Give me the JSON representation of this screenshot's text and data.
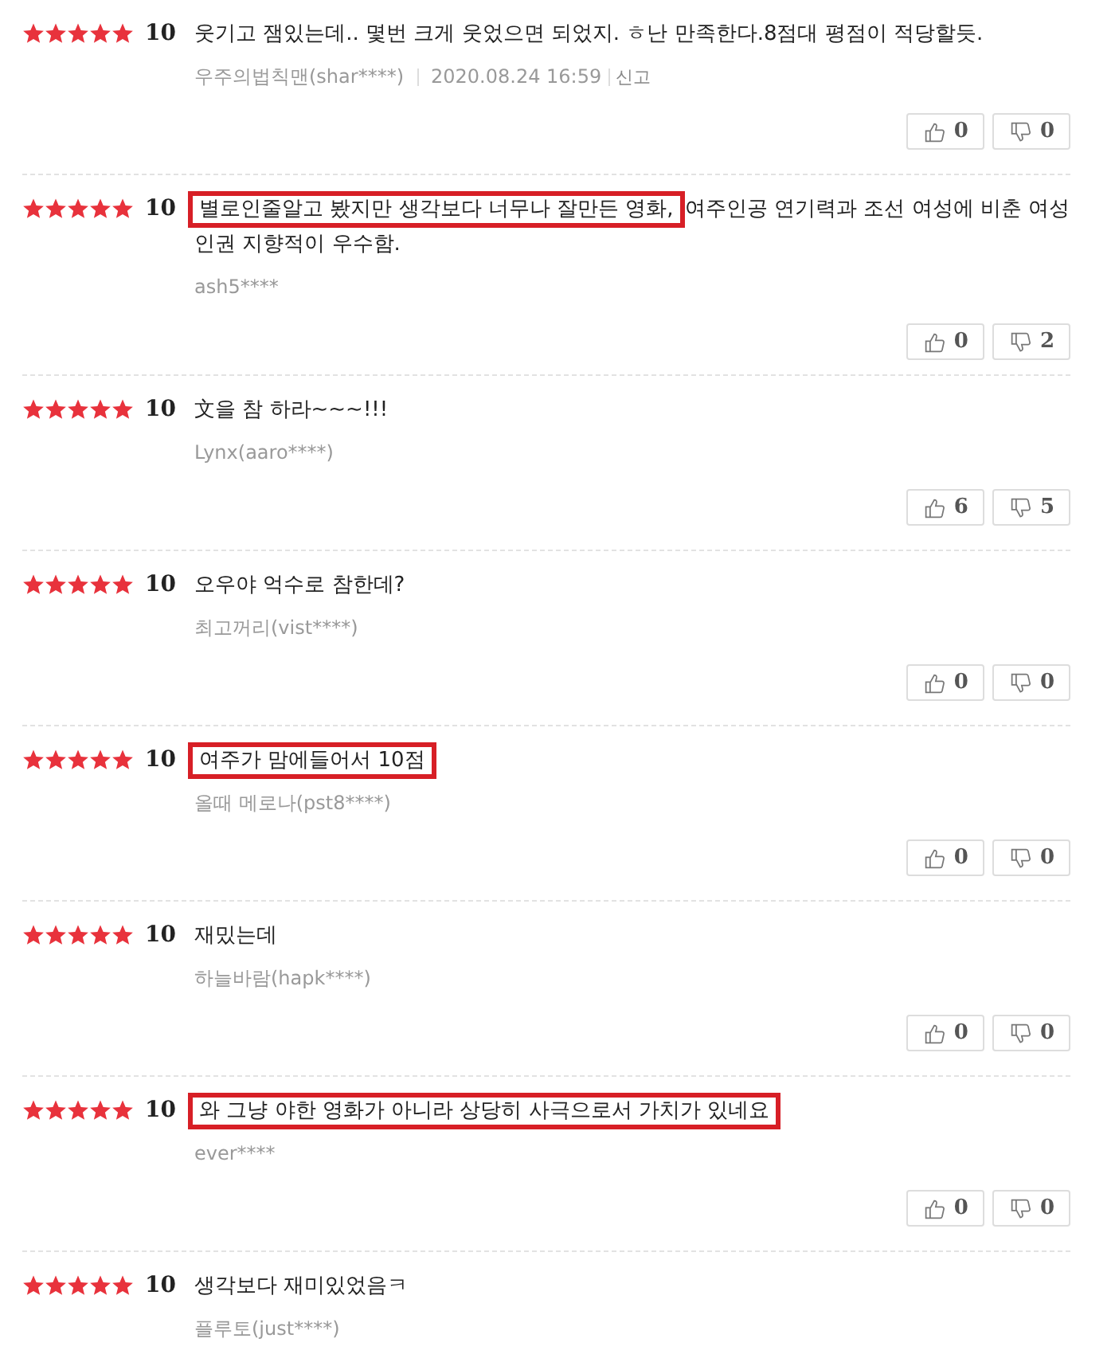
{
  "reviews": [
    {
      "stars": 5,
      "score": "10",
      "text": [
        {
          "text": "웃기고 잼있는데.. 몇번 크게 웃었으면 되었지. ㅎ난 만족한다.8점대 평점이 적당할듯.",
          "boxed": false
        }
      ],
      "author": "우주의법칙맨(shar****)",
      "date": "2020.08.24 16:59",
      "report": "신고",
      "likes": "0",
      "dislikes": "0"
    },
    {
      "stars": 5,
      "score": "10",
      "text": [
        {
          "text": "별로인줄알고 봤지만 생각보다 너무나 잘만든 영화,",
          "boxed": true
        },
        {
          "text": " 여주인공 연기력과 조선 여성에 비춘 여성 인권 지향적이 우수함.",
          "boxed": false
        }
      ],
      "author": "ash5****",
      "likes": "0",
      "dislikes": "2"
    },
    {
      "stars": 5,
      "score": "10",
      "text": [
        {
          "text": "文을 참 하라~~~!!!",
          "boxed": false
        }
      ],
      "author": "Lynx(aaro****)",
      "likes": "6",
      "dislikes": "5"
    },
    {
      "stars": 5,
      "score": "10",
      "text": [
        {
          "text": "오우야 억수로 참한데?",
          "boxed": false
        }
      ],
      "author": "최고꺼리(vist****)",
      "likes": "0",
      "dislikes": "0"
    },
    {
      "stars": 5,
      "score": "10",
      "text": [
        {
          "text": "여주가 맘에들어서 10점",
          "boxed": true
        }
      ],
      "author": "올때 메로나(pst8****)",
      "likes": "0",
      "dislikes": "0"
    },
    {
      "stars": 5,
      "score": "10",
      "text": [
        {
          "text": "재밌는데",
          "boxed": false
        }
      ],
      "author": "하늘바람(hapk****)",
      "likes": "0",
      "dislikes": "0"
    },
    {
      "stars": 5,
      "score": "10",
      "text": [
        {
          "text": "와 그냥 야한 영화가 아니라 상당히 사극으로서 가치가 있네요",
          "boxed": true
        }
      ],
      "author": "ever****",
      "likes": "0",
      "dislikes": "0"
    },
    {
      "stars": 5,
      "score": "10",
      "text": [
        {
          "text": "생각보다 재미있었음ㅋ",
          "boxed": false
        }
      ],
      "author": "플루토(just****)"
    }
  ]
}
